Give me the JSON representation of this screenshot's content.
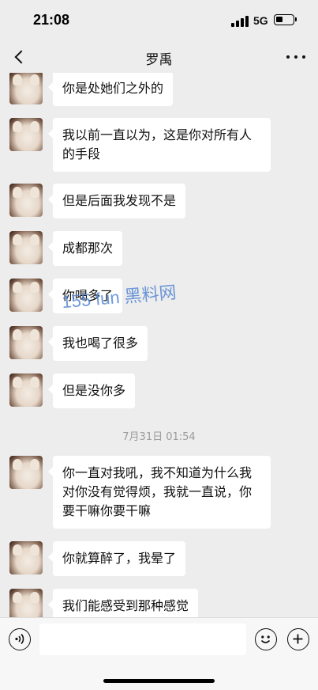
{
  "status_bar": {
    "time": "21:08",
    "network": "5G"
  },
  "header": {
    "title": "罗禹"
  },
  "messages": [
    {
      "text": "你是处她们之外的"
    },
    {
      "text": "我以前一直以为，这是你对所有人的手段"
    },
    {
      "text": "但是后面我发现不是"
    },
    {
      "text": "成都那次"
    },
    {
      "text": "你喝多了"
    },
    {
      "text": "我也喝了很多"
    },
    {
      "text": "但是没你多"
    },
    {
      "text": "你一直对我吼，我不知道为什么我对你没有觉得烦，我就一直说，你要干嘛你要干嘛"
    },
    {
      "text": "你就算醉了，我晕了"
    },
    {
      "text": "我们能感受到那种感觉"
    }
  ],
  "timestamp": "7月31日 01:54",
  "watermark": "155 fun 黑料网",
  "input": {
    "placeholder": ""
  }
}
